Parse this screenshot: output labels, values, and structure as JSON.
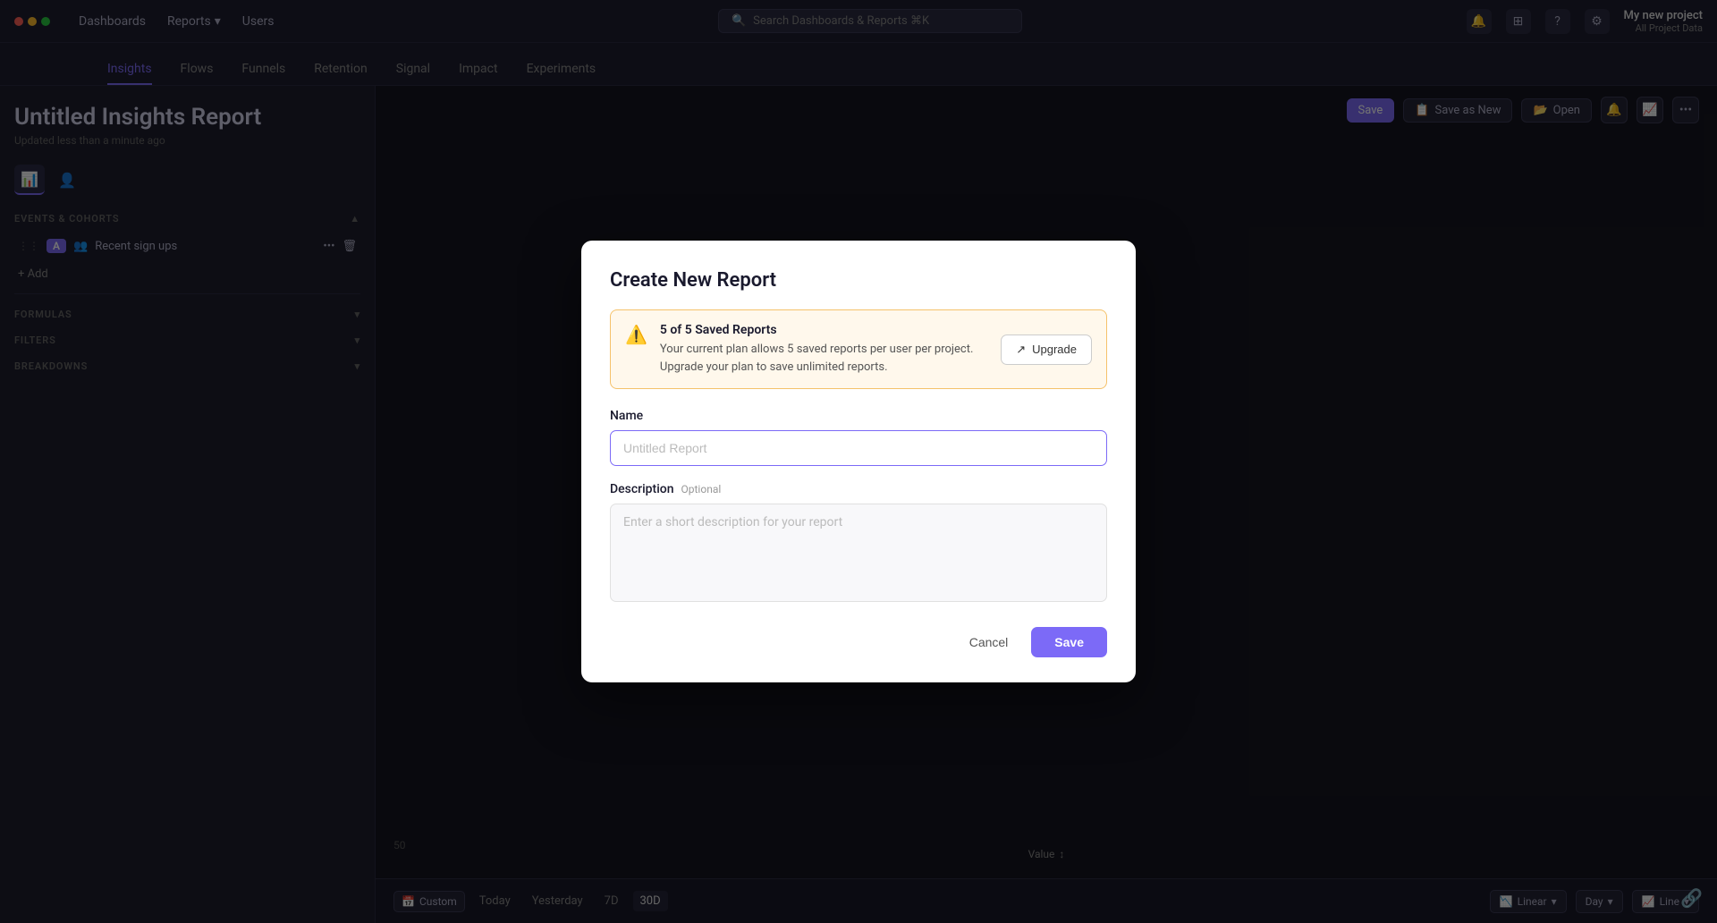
{
  "app": {
    "dots": [
      "red",
      "yellow",
      "green"
    ]
  },
  "nav": {
    "items": [
      {
        "label": "Dashboards",
        "hasDropdown": false
      },
      {
        "label": "Reports",
        "hasDropdown": true
      },
      {
        "label": "Users",
        "hasDropdown": false
      }
    ],
    "search_placeholder": "Search Dashboards & Reports ⌘K",
    "project_name": "My new project",
    "project_sub": "All Project Data"
  },
  "tabs": [
    {
      "label": "Insights",
      "active": true
    },
    {
      "label": "Flows",
      "active": false
    },
    {
      "label": "Funnels",
      "active": false
    },
    {
      "label": "Retention",
      "active": false
    },
    {
      "label": "Signal",
      "active": false
    },
    {
      "label": "Impact",
      "active": false
    },
    {
      "label": "Experiments",
      "active": false
    }
  ],
  "sidebar": {
    "page_title": "Untitled Insights Report",
    "page_subtitle": "Updated less than a minute ago",
    "events_label": "EVENTS & COHORTS",
    "formulas_label": "FORMULAS",
    "filters_label": "FILTERS",
    "breakdowns_label": "BREAKDOWNS",
    "event_name": "Recent sign ups",
    "event_key": "A",
    "add_label": "+ Add"
  },
  "toolbar": {
    "save_label": "Save",
    "save_new_label": "Save as New",
    "open_label": "Open"
  },
  "bottom": {
    "time_buttons": [
      "Custom",
      "Today",
      "Yesterday",
      "7D",
      "30D"
    ],
    "active_time": "30D",
    "linear_label": "Linear",
    "day_label": "Day",
    "line_label": "Line"
  },
  "chart": {
    "y_value": "50",
    "value_label": "Value"
  },
  "modal": {
    "title": "Create New Report",
    "warning_title": "5 of 5 Saved Reports",
    "warning_body": "Your current plan allows 5 saved reports per user per project. Upgrade your plan to save unlimited reports.",
    "upgrade_label": "Upgrade",
    "name_label": "Name",
    "name_placeholder": "Untitled Report",
    "desc_label": "Description",
    "desc_optional": "Optional",
    "desc_placeholder": "Enter a short description for your report",
    "cancel_label": "Cancel",
    "save_label": "Save"
  }
}
